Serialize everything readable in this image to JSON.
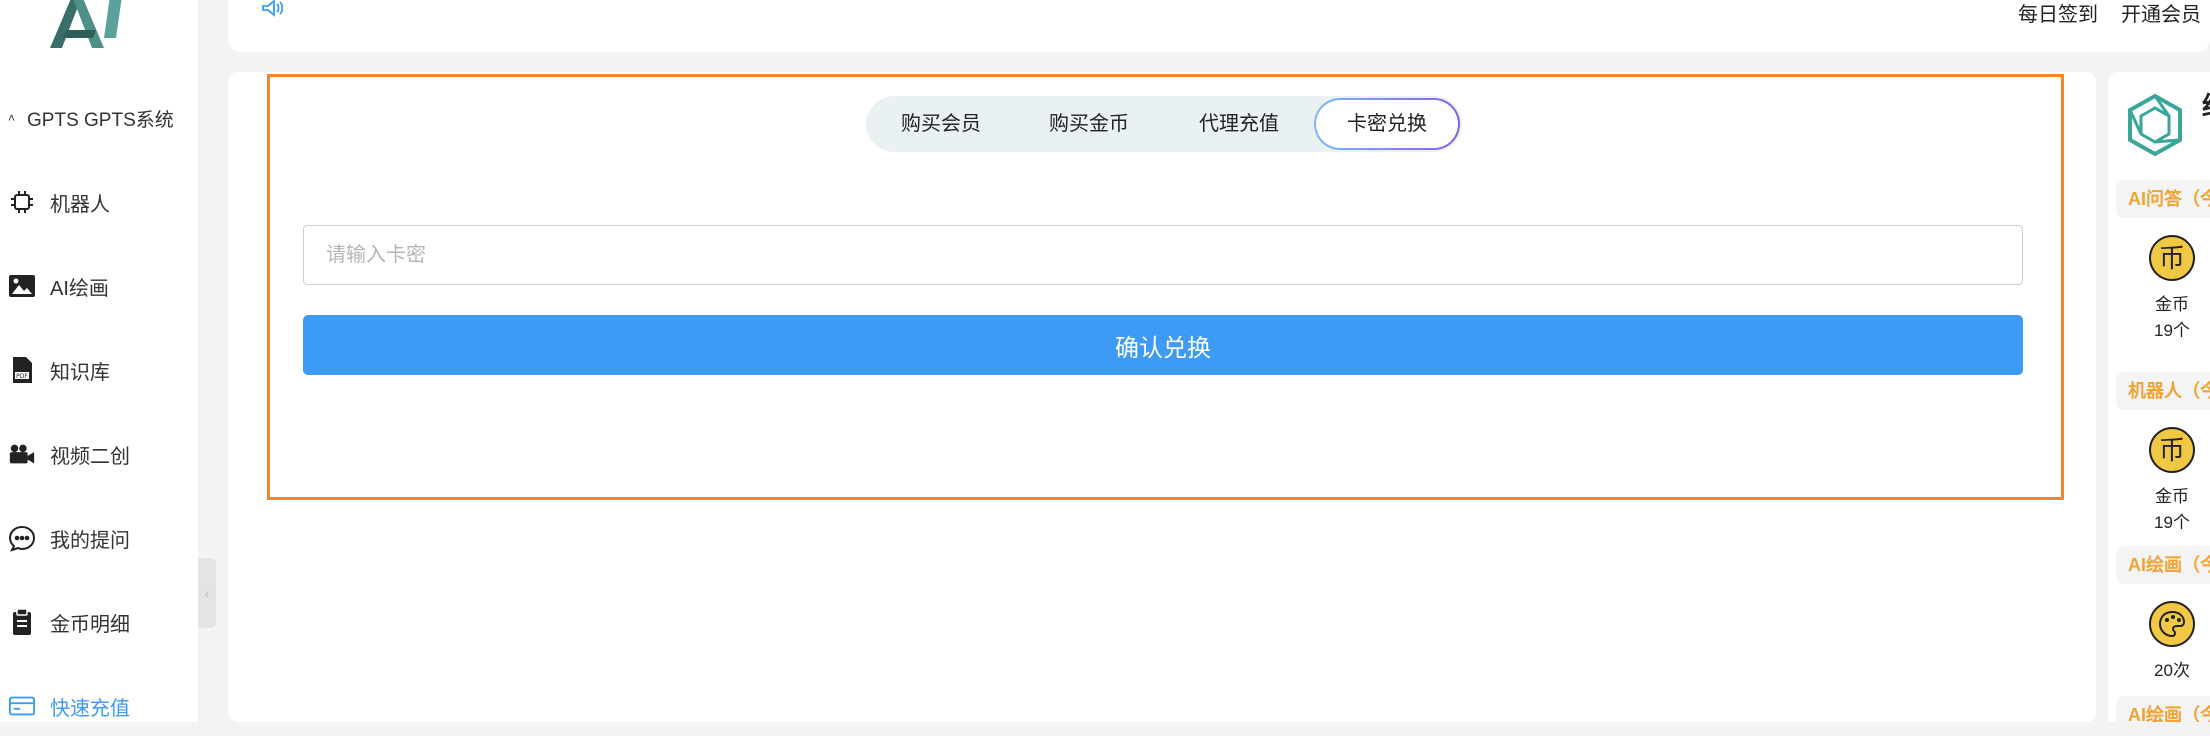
{
  "sidebar": {
    "items": [
      {
        "label": "GPTS GPTS系统",
        "icon": "chevron-up-icon"
      },
      {
        "label": "机器人",
        "icon": "chip-icon"
      },
      {
        "label": "AI绘画",
        "icon": "image-icon"
      },
      {
        "label": "知识库",
        "icon": "pdf-file-icon"
      },
      {
        "label": "视频二创",
        "icon": "video-camera-icon"
      },
      {
        "label": "我的提问",
        "icon": "chat-bubble-icon"
      },
      {
        "label": "金币明细",
        "icon": "clipboard-icon"
      },
      {
        "label": "快速充值",
        "icon": "credit-card-icon",
        "active": true
      }
    ]
  },
  "header": {
    "checkin_label": "每日签到",
    "membership_label": "开通会员"
  },
  "tabs": [
    {
      "label": "购买会员"
    },
    {
      "label": "购买金币"
    },
    {
      "label": "代理充值"
    },
    {
      "label": "卡密兑换",
      "active": true
    }
  ],
  "redeem": {
    "value": "",
    "placeholder": "请输入卡密",
    "button_label": "确认兑换"
  },
  "right_panel": {
    "title": "结",
    "sections": [
      {
        "title": "AI问答（今",
        "unit_label": "金币",
        "count": "19个"
      },
      {
        "title": "机器人（今",
        "unit_label": "金币",
        "count": "19个"
      },
      {
        "title": "AI绘画（今",
        "count": "20次"
      },
      {
        "title": "AI绘画（今"
      }
    ]
  },
  "colors": {
    "accent": "#3d9af5",
    "highlight_border": "#f6872f",
    "section_title": "#f0a233",
    "coin": "#f0c844"
  }
}
